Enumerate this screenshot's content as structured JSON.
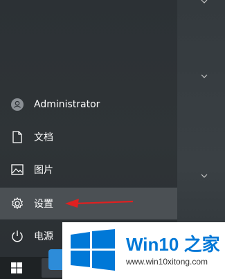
{
  "start_menu": {
    "user": {
      "label": "Administrator",
      "icon": "user-avatar-icon"
    },
    "items": [
      {
        "label": "文档",
        "icon": "document-icon"
      },
      {
        "label": "图片",
        "icon": "pictures-icon"
      },
      {
        "label": "设置",
        "icon": "gear-icon",
        "selected": true
      },
      {
        "label": "电源",
        "icon": "power-icon"
      }
    ]
  },
  "tiles": {
    "chevron_icon": "chevron-down-icon"
  },
  "annotation": {
    "color": "#e02020",
    "icon": "red-arrow"
  },
  "watermark": {
    "title_part1": "Win10 ",
    "title_part2": "之家",
    "url": "www.win10xitong.com",
    "logo_color": "#0078d7"
  },
  "taskbar": {
    "start_icon": "windows-logo-icon"
  }
}
